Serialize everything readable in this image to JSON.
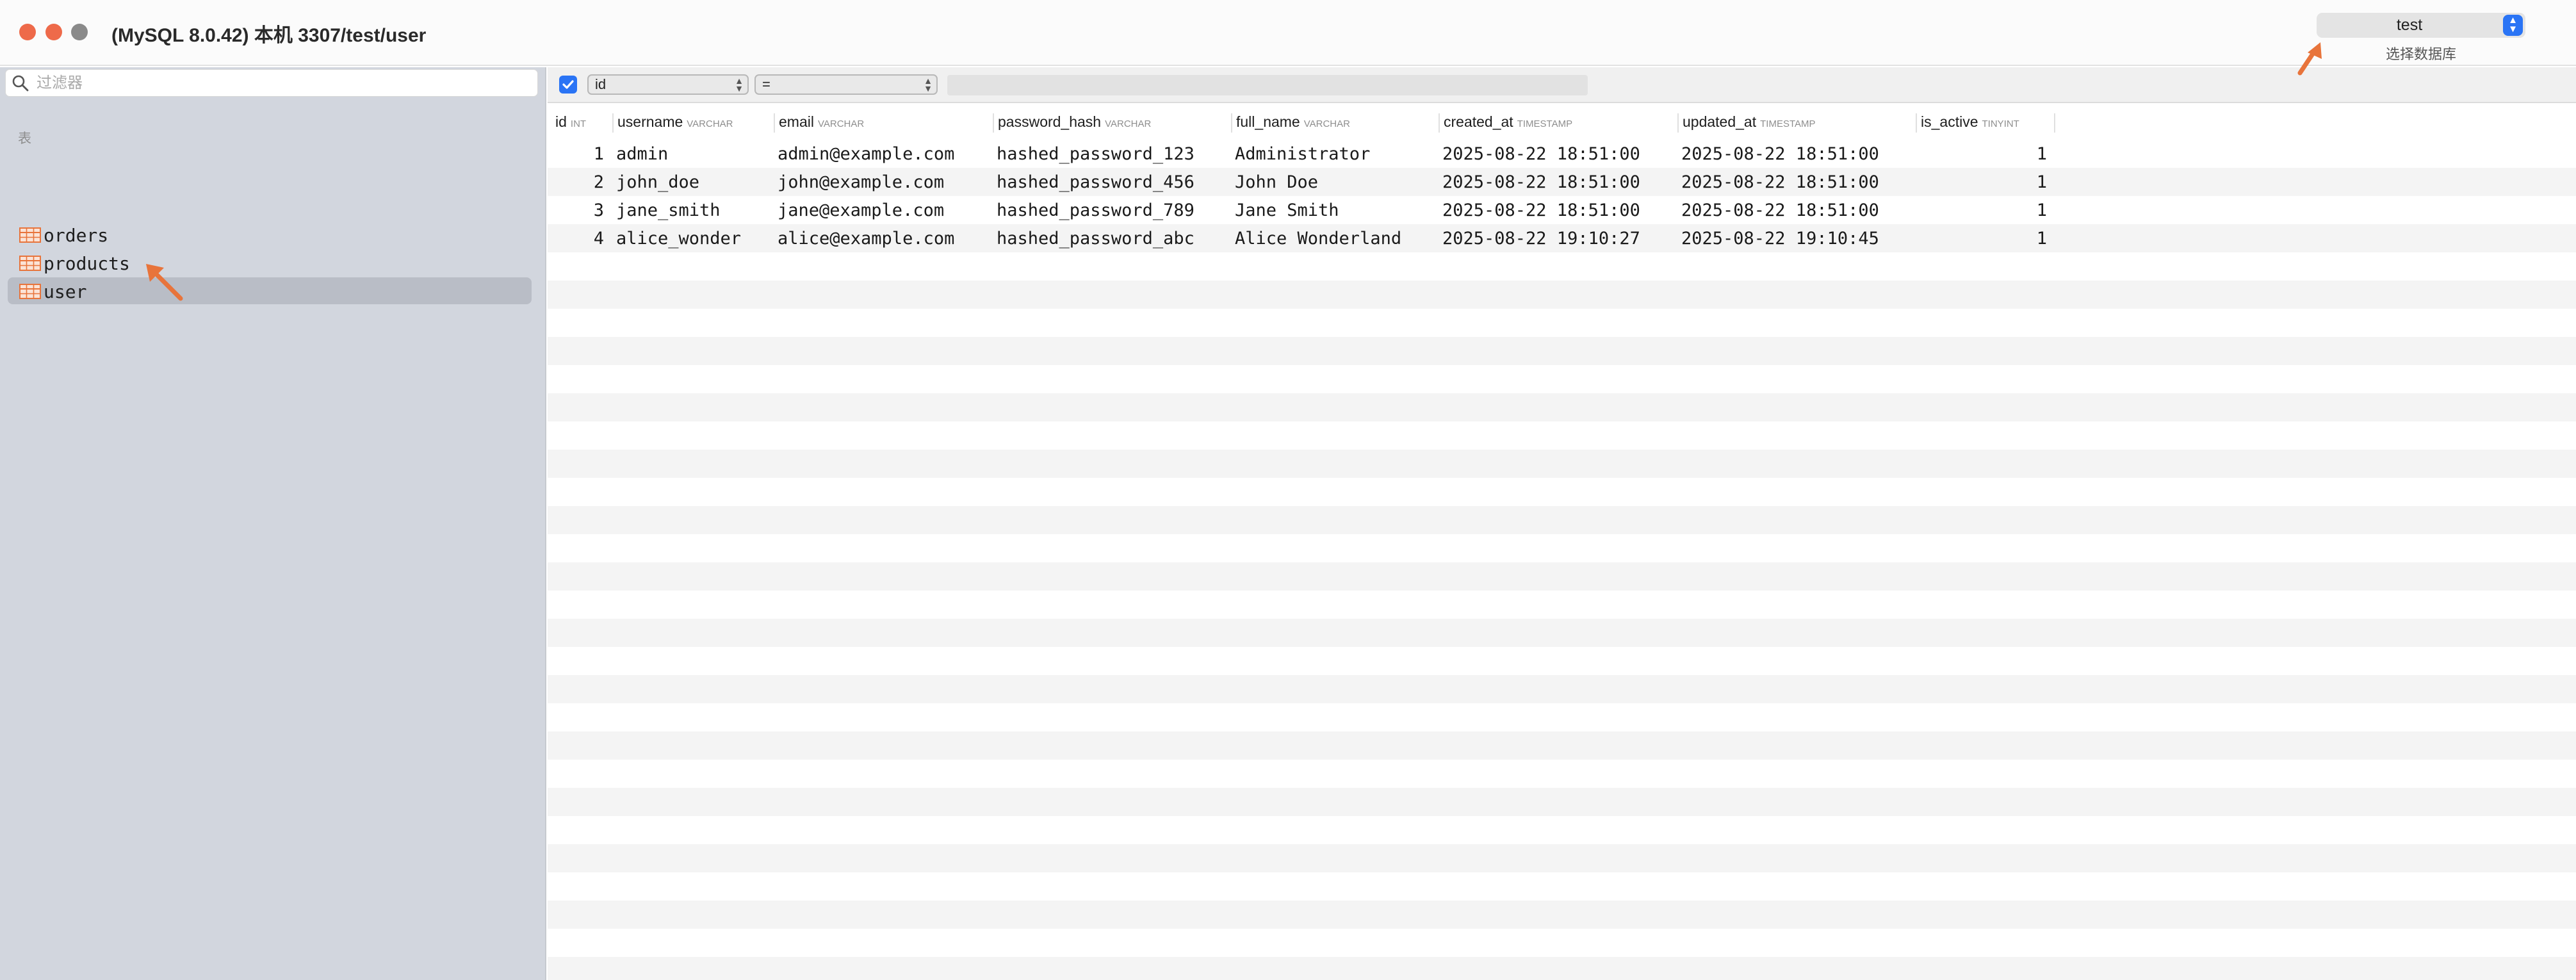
{
  "window": {
    "title": "(MySQL 8.0.42) 本机 3307/test/user"
  },
  "database_picker": {
    "selected": "test",
    "caption": "选择数据库"
  },
  "sidebar": {
    "filter_placeholder": "过滤器",
    "section_label": "表",
    "tables": [
      {
        "name": "orders",
        "selected": false
      },
      {
        "name": "products",
        "selected": false
      },
      {
        "name": "user",
        "selected": true
      }
    ]
  },
  "filter": {
    "enabled": true,
    "column": "id",
    "operator": "=",
    "value": ""
  },
  "grid": {
    "columns": [
      {
        "name": "id",
        "type": "INT"
      },
      {
        "name": "username",
        "type": "VARCHAR"
      },
      {
        "name": "email",
        "type": "VARCHAR"
      },
      {
        "name": "password_hash",
        "type": "VARCHAR"
      },
      {
        "name": "full_name",
        "type": "VARCHAR"
      },
      {
        "name": "created_at",
        "type": "TIMESTAMP"
      },
      {
        "name": "updated_at",
        "type": "TIMESTAMP"
      },
      {
        "name": "is_active",
        "type": "TINYINT"
      }
    ],
    "rows": [
      [
        "1",
        "admin",
        "admin@example.com",
        "hashed_password_123",
        "Administrator",
        "2025-08-22 18:51:00",
        "2025-08-22 18:51:00",
        "1"
      ],
      [
        "2",
        "john_doe",
        "john@example.com",
        "hashed_password_456",
        "John Doe",
        "2025-08-22 18:51:00",
        "2025-08-22 18:51:00",
        "1"
      ],
      [
        "3",
        "jane_smith",
        "jane@example.com",
        "hashed_password_789",
        "Jane Smith",
        "2025-08-22 18:51:00",
        "2025-08-22 18:51:00",
        "1"
      ],
      [
        "4",
        "alice_wonder",
        "alice@example.com",
        "hashed_password_abc",
        "Alice Wonderland",
        "2025-08-22 19:10:27",
        "2025-08-22 19:10:45",
        "1"
      ]
    ]
  },
  "colors": {
    "accent": "#2a74f5",
    "annotation_arrow": "#e8743b",
    "table_icon": "#e8743b"
  }
}
